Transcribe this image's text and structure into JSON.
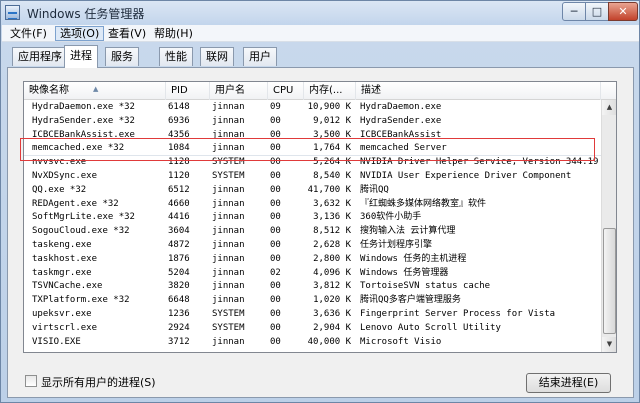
{
  "window": {
    "title": "Windows 任务管理器",
    "minimize_glyph": "─",
    "maximize_glyph": "□",
    "close_glyph": "✕"
  },
  "menu": [
    {
      "label": "文件(F)"
    },
    {
      "label": "选项(O)"
    },
    {
      "label": "查看(V)"
    },
    {
      "label": "帮助(H)"
    }
  ],
  "tabs": [
    {
      "label": "应用程序"
    },
    {
      "label": "进程"
    },
    {
      "label": "服务"
    },
    {
      "label": "性能"
    },
    {
      "label": "联网"
    },
    {
      "label": "用户"
    }
  ],
  "active_tab": "进程",
  "columns": {
    "name": "映像名称",
    "pid": "PID",
    "user": "用户名",
    "cpu": "CPU",
    "mem": "内存(...",
    "desc": "描述"
  },
  "processes": [
    {
      "name": "HydraDaemon.exe *32",
      "pid": "6148",
      "user": "jinnan",
      "cpu": "09",
      "mem": "10,900 K",
      "desc": "HydraDaemon.exe"
    },
    {
      "name": "HydraSender.exe *32",
      "pid": "6936",
      "user": "jinnan",
      "cpu": "00",
      "mem": "9,012 K",
      "desc": "HydraSender.exe"
    },
    {
      "name": "ICBCEBankAssist.exe",
      "pid": "4356",
      "user": "jinnan",
      "cpu": "00",
      "mem": "3,500 K",
      "desc": "ICBCEBankAssist"
    },
    {
      "name": "memcached.exe *32",
      "pid": "1084",
      "user": "jinnan",
      "cpu": "00",
      "mem": "1,764 K",
      "desc": "memcached Server"
    },
    {
      "name": "nvvsvc.exe",
      "pid": "1128",
      "user": "SYSTEM",
      "cpu": "00",
      "mem": "5,264 K",
      "desc": "NVIDIA Driver Helper Service, Version 344.19"
    },
    {
      "name": "NvXDSync.exe",
      "pid": "1120",
      "user": "SYSTEM",
      "cpu": "00",
      "mem": "8,540 K",
      "desc": "NVIDIA User Experience Driver Component"
    },
    {
      "name": "QQ.exe *32",
      "pid": "6512",
      "user": "jinnan",
      "cpu": "00",
      "mem": "41,700 K",
      "desc": "腾讯QQ"
    },
    {
      "name": "REDAgent.exe *32",
      "pid": "4660",
      "user": "jinnan",
      "cpu": "00",
      "mem": "3,632 K",
      "desc": "『红蜘蛛多媒体网络教室』软件"
    },
    {
      "name": "SoftMgrLite.exe *32",
      "pid": "4416",
      "user": "jinnan",
      "cpu": "00",
      "mem": "3,136 K",
      "desc": "360软件小助手"
    },
    {
      "name": "SogouCloud.exe *32",
      "pid": "3604",
      "user": "jinnan",
      "cpu": "00",
      "mem": "8,512 K",
      "desc": "搜狗输入法 云计算代理"
    },
    {
      "name": "taskeng.exe",
      "pid": "4872",
      "user": "jinnan",
      "cpu": "00",
      "mem": "2,628 K",
      "desc": "任务计划程序引擎"
    },
    {
      "name": "taskhost.exe",
      "pid": "1876",
      "user": "jinnan",
      "cpu": "00",
      "mem": "2,800 K",
      "desc": "Windows 任务的主机进程"
    },
    {
      "name": "taskmgr.exe",
      "pid": "5204",
      "user": "jinnan",
      "cpu": "02",
      "mem": "4,096 K",
      "desc": "Windows 任务管理器"
    },
    {
      "name": "TSVNCache.exe",
      "pid": "3820",
      "user": "jinnan",
      "cpu": "00",
      "mem": "3,812 K",
      "desc": "TortoiseSVN status cache"
    },
    {
      "name": "TXPlatform.exe *32",
      "pid": "6648",
      "user": "jinnan",
      "cpu": "00",
      "mem": "1,020 K",
      "desc": "腾讯QQ多客户端管理服务"
    },
    {
      "name": "upeksvr.exe",
      "pid": "1236",
      "user": "SYSTEM",
      "cpu": "00",
      "mem": "3,636 K",
      "desc": "Fingerprint Server Process for Vista"
    },
    {
      "name": "virtscrl.exe",
      "pid": "2924",
      "user": "SYSTEM",
      "cpu": "00",
      "mem": "2,904 K",
      "desc": "Lenovo Auto Scroll Utility"
    },
    {
      "name": "VISIO.EXE",
      "pid": "3712",
      "user": "jinnan",
      "cpu": "00",
      "mem": "40,000 K",
      "desc": "Microsoft Visio"
    }
  ],
  "show_all_users_label": "显示所有用户的进程(S)",
  "end_process_label": "结束进程(E)",
  "scroll": {
    "up_glyph": "▲",
    "down_glyph": "▼"
  },
  "sort_glyph": "▲",
  "colors": {
    "annotation_box": "#e03a3a",
    "title_bar": "#c9d9ec"
  }
}
